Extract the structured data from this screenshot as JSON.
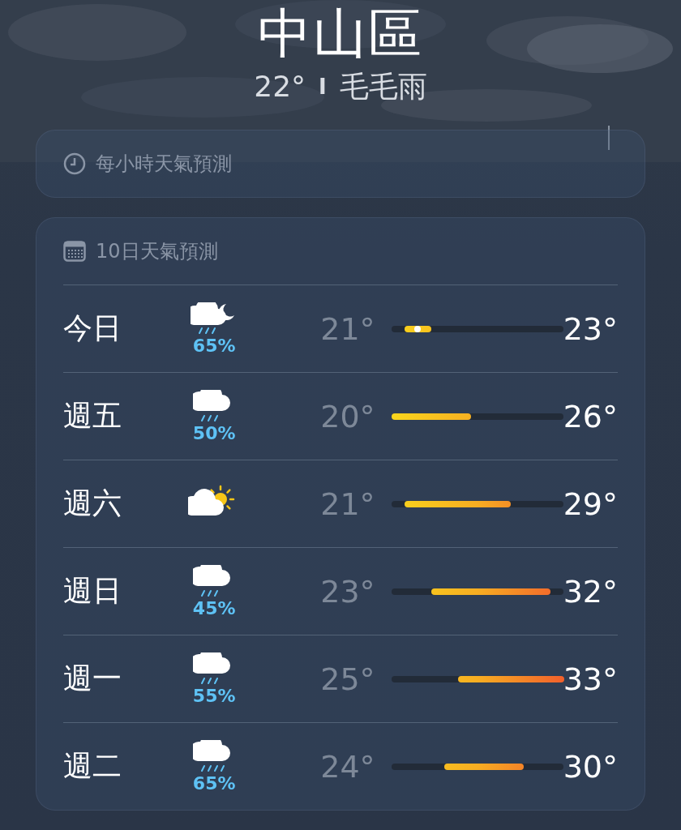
{
  "location": {
    "name": "中山區",
    "temperature": "22°",
    "separator": "I",
    "condition": "毛毛雨"
  },
  "hourly_card": {
    "title": "每小時天氣預測"
  },
  "daily_card": {
    "title": "10日天氣預測",
    "days": [
      {
        "day": "今日",
        "kind": "cloud-moon-rain",
        "precip": "65%",
        "low": "21°",
        "high": "23°"
      },
      {
        "day": "週五",
        "kind": "cloud-rain",
        "precip": "50%",
        "low": "20°",
        "high": "26°"
      },
      {
        "day": "週六",
        "kind": "cloud-sun",
        "low": "21°",
        "high": "29°"
      },
      {
        "day": "週日",
        "kind": "cloud-rain",
        "precip": "45%",
        "low": "23°",
        "high": "32°"
      },
      {
        "day": "週一",
        "kind": "cloud-rain",
        "precip": "55%",
        "low": "25°",
        "high": "33°"
      },
      {
        "day": "週二",
        "kind": "cloud-heavy-rain",
        "precip": "65%",
        "low": "24°",
        "high": "30°"
      }
    ]
  }
}
